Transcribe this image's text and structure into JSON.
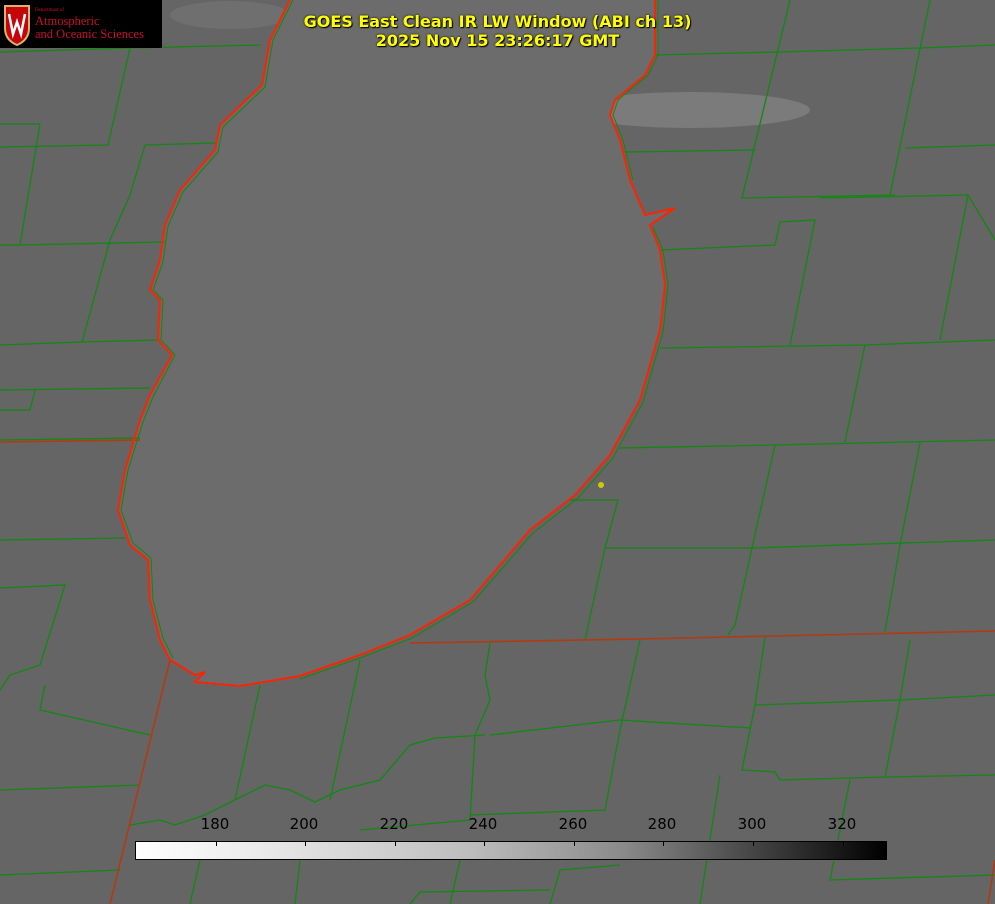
{
  "title": {
    "line1": "GOES East Clean IR LW Window (ABI ch 13)",
    "line2": "2025 Nov 15 23:26:17 GMT"
  },
  "logo": {
    "department": "Department of",
    "line1": "Atmospheric",
    "line2": "and Oceanic Sciences",
    "shield_letter": "W"
  },
  "colorbar": {
    "ticks": [
      "180",
      "200",
      "220",
      "240",
      "260",
      "280",
      "300",
      "320"
    ],
    "range": [
      162,
      330
    ],
    "colormap": "white-to-black"
  },
  "colors": {
    "title": "#ffff00",
    "coastline": "#ff2200",
    "county_lines": "#118811",
    "marker": "#cccc00"
  }
}
